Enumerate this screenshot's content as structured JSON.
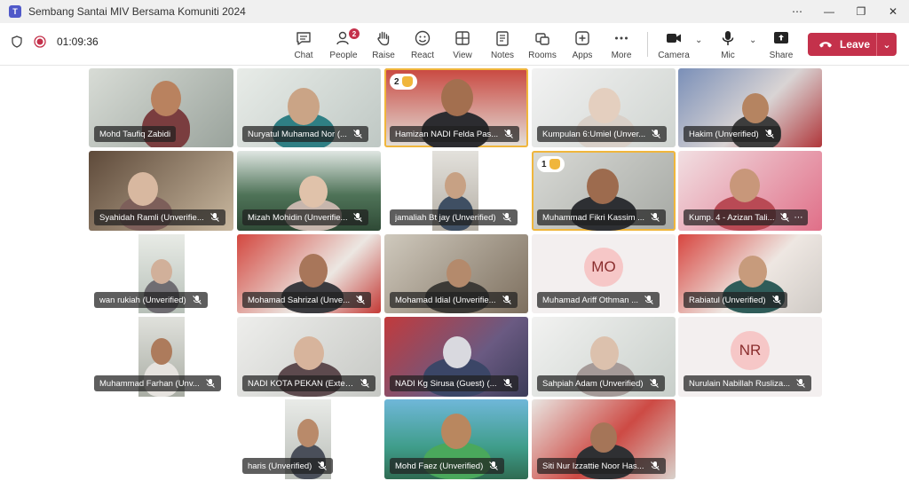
{
  "window": {
    "title": "Sembang Santai MIV Bersama Komuniti 2024",
    "app_icon": "T",
    "controls": [
      "⋯",
      "—",
      "❐",
      "✕"
    ]
  },
  "toolbar": {
    "timer": "01:09:36",
    "chat": "Chat",
    "people": "People",
    "people_count": "2",
    "raise": "Raise",
    "react": "React",
    "view": "View",
    "notes": "Notes",
    "rooms": "Rooms",
    "apps": "Apps",
    "more": "More",
    "camera": "Camera",
    "mic": "Mic",
    "share": "Share",
    "leave": "Leave"
  },
  "colors": {
    "accent": "#5b5fc7",
    "leave": "#c4314b",
    "highlight": "#f0b63c"
  },
  "participants": [
    {
      "name": "Mohd Taufiq Zabidi"
    },
    {
      "name": "Nuryatul Muhamad Nor (..."
    },
    {
      "name": "Hamizan NADI Felda Pas...",
      "hand": "2"
    },
    {
      "name": "Kumpulan 6:Umiel (Unver..."
    },
    {
      "name": "Hakim (Unverified)"
    },
    {
      "name": "Syahidah Ramli (Unverifie..."
    },
    {
      "name": "Mizah Mohidin (Unverifie..."
    },
    {
      "name": "jamaliah Bt jay (Unverified)"
    },
    {
      "name": "Muhammad Fikri Kassim ...",
      "hand": "1"
    },
    {
      "name": "Kump. 4 - Azizan Tali..."
    },
    {
      "name": "wan rukiah (Unverified)"
    },
    {
      "name": "Mohamad Sahrizal (Unve..."
    },
    {
      "name": "Mohamad Idial (Unverifie..."
    },
    {
      "name": "Muhamad Ariff Othman ...",
      "initials": "MO"
    },
    {
      "name": "Rabiatul (Unverified)"
    },
    {
      "name": "Muhammad Farhan (Unv..."
    },
    {
      "name": "NADI KOTA PEKAN (Exter..."
    },
    {
      "name": "NADI Kg Sirusa (Guest) (..."
    },
    {
      "name": "Sahpiah Adam (Unverified)"
    },
    {
      "name": "Nurulain Nabillah Rusliza...",
      "initials": "NR"
    },
    {
      "name": "haris (Unverified)"
    },
    {
      "name": "Mohd Faez (Unverified)"
    },
    {
      "name": "Siti Nur Izzattie Noor Has..."
    }
  ]
}
